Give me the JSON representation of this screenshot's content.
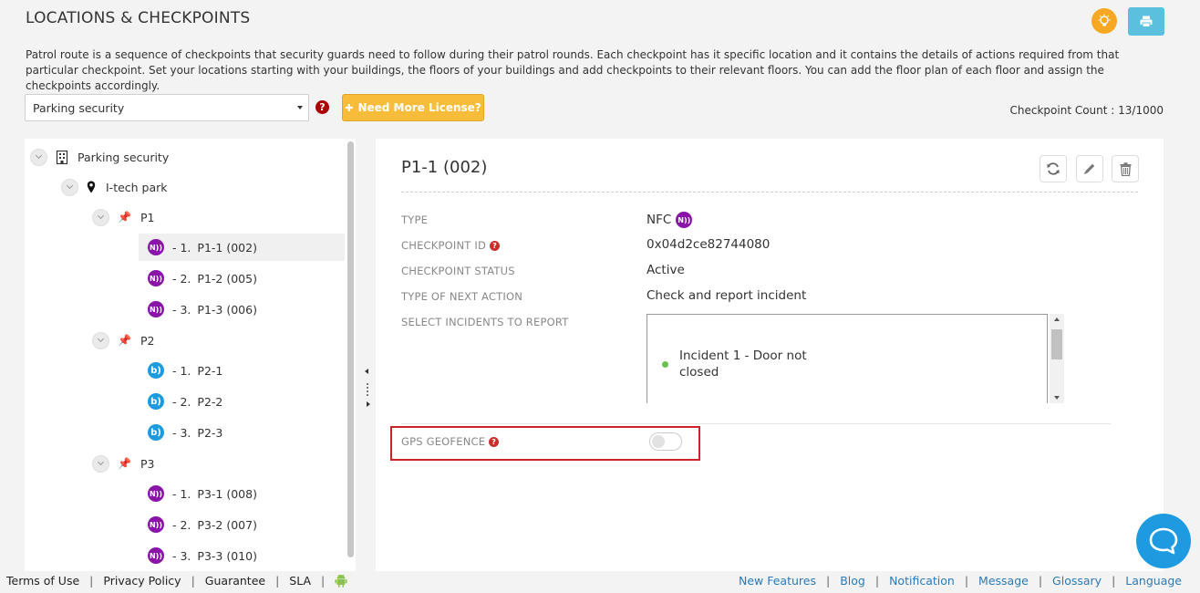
{
  "page": {
    "title": "LOCATIONS & CHECKPOINTS",
    "description": "Patrol route is a sequence of checkpoints that security guards need to follow during their patrol rounds. Each checkpoint has it specific location and it contains the details of actions required from that particular checkpoint. Set your locations starting with your buildings, the floors of your buildings and add checkpoints to their relevant floors. You can add the floor plan of each floor and assign the checkpoints accordingly."
  },
  "toolbar": {
    "route_select_value": "Parking security",
    "license_button": "Need More License?",
    "checkpoint_count": "Checkpoint Count : 13/1000"
  },
  "tree": {
    "root": "Parking security",
    "site": "I-tech park",
    "groups": [
      {
        "name": "P1",
        "items": [
          {
            "index": "-  1.",
            "label": "P1-1 (002)",
            "type": "nfc"
          },
          {
            "index": "-  2.",
            "label": "P1-2 (005)",
            "type": "nfc"
          },
          {
            "index": "-  3.",
            "label": "P1-3 (006)",
            "type": "nfc"
          }
        ]
      },
      {
        "name": "P2",
        "items": [
          {
            "index": "-  1.",
            "label": "P2-1",
            "type": "beacon"
          },
          {
            "index": "-  2.",
            "label": "P2-2",
            "type": "beacon"
          },
          {
            "index": "-  3.",
            "label": "P2-3",
            "type": "beacon"
          }
        ]
      },
      {
        "name": "P3",
        "items": [
          {
            "index": "-  1.",
            "label": "P3-1 (008)",
            "type": "nfc"
          },
          {
            "index": "-  2.",
            "label": "P3-2 (007)",
            "type": "nfc"
          },
          {
            "index": "-  3.",
            "label": "P3-3 (010)",
            "type": "nfc"
          }
        ]
      }
    ]
  },
  "icons": {
    "nfc_glyph": "N))",
    "beacon_glyph": "b)",
    "help_glyph": "?",
    "plus_glyph": "✚"
  },
  "detail": {
    "title": "P1-1 (002)",
    "fields": {
      "type_label": "TYPE",
      "type_value": "NFC",
      "id_label": "CHECKPOINT ID",
      "id_value": "0x04d2ce82744080",
      "status_label": "CHECKPOINT STATUS",
      "status_value": "Active",
      "next_action_label": "TYPE OF NEXT ACTION",
      "next_action_value": "Check and report incident",
      "incidents_label": "SELECT INCIDENTS TO REPORT",
      "geofence_label": "GPS GEOFENCE"
    },
    "incidents": [
      "Incident 1 - Door not closed"
    ],
    "geofence_enabled": false
  },
  "footer": {
    "left": [
      "Terms of Use",
      "Privacy Policy",
      "Guarantee",
      "SLA"
    ],
    "right": [
      "New Features",
      "Blog",
      "Notification",
      "Message",
      "Glossary",
      "Language"
    ]
  },
  "colors": {
    "nfc": "#8b14a8",
    "beacon": "#1e9be0",
    "license_button": "#f7bc3a",
    "print_button": "#5bc0de",
    "highlight": "#d0202a",
    "footer_link": "#2a7ab8"
  }
}
